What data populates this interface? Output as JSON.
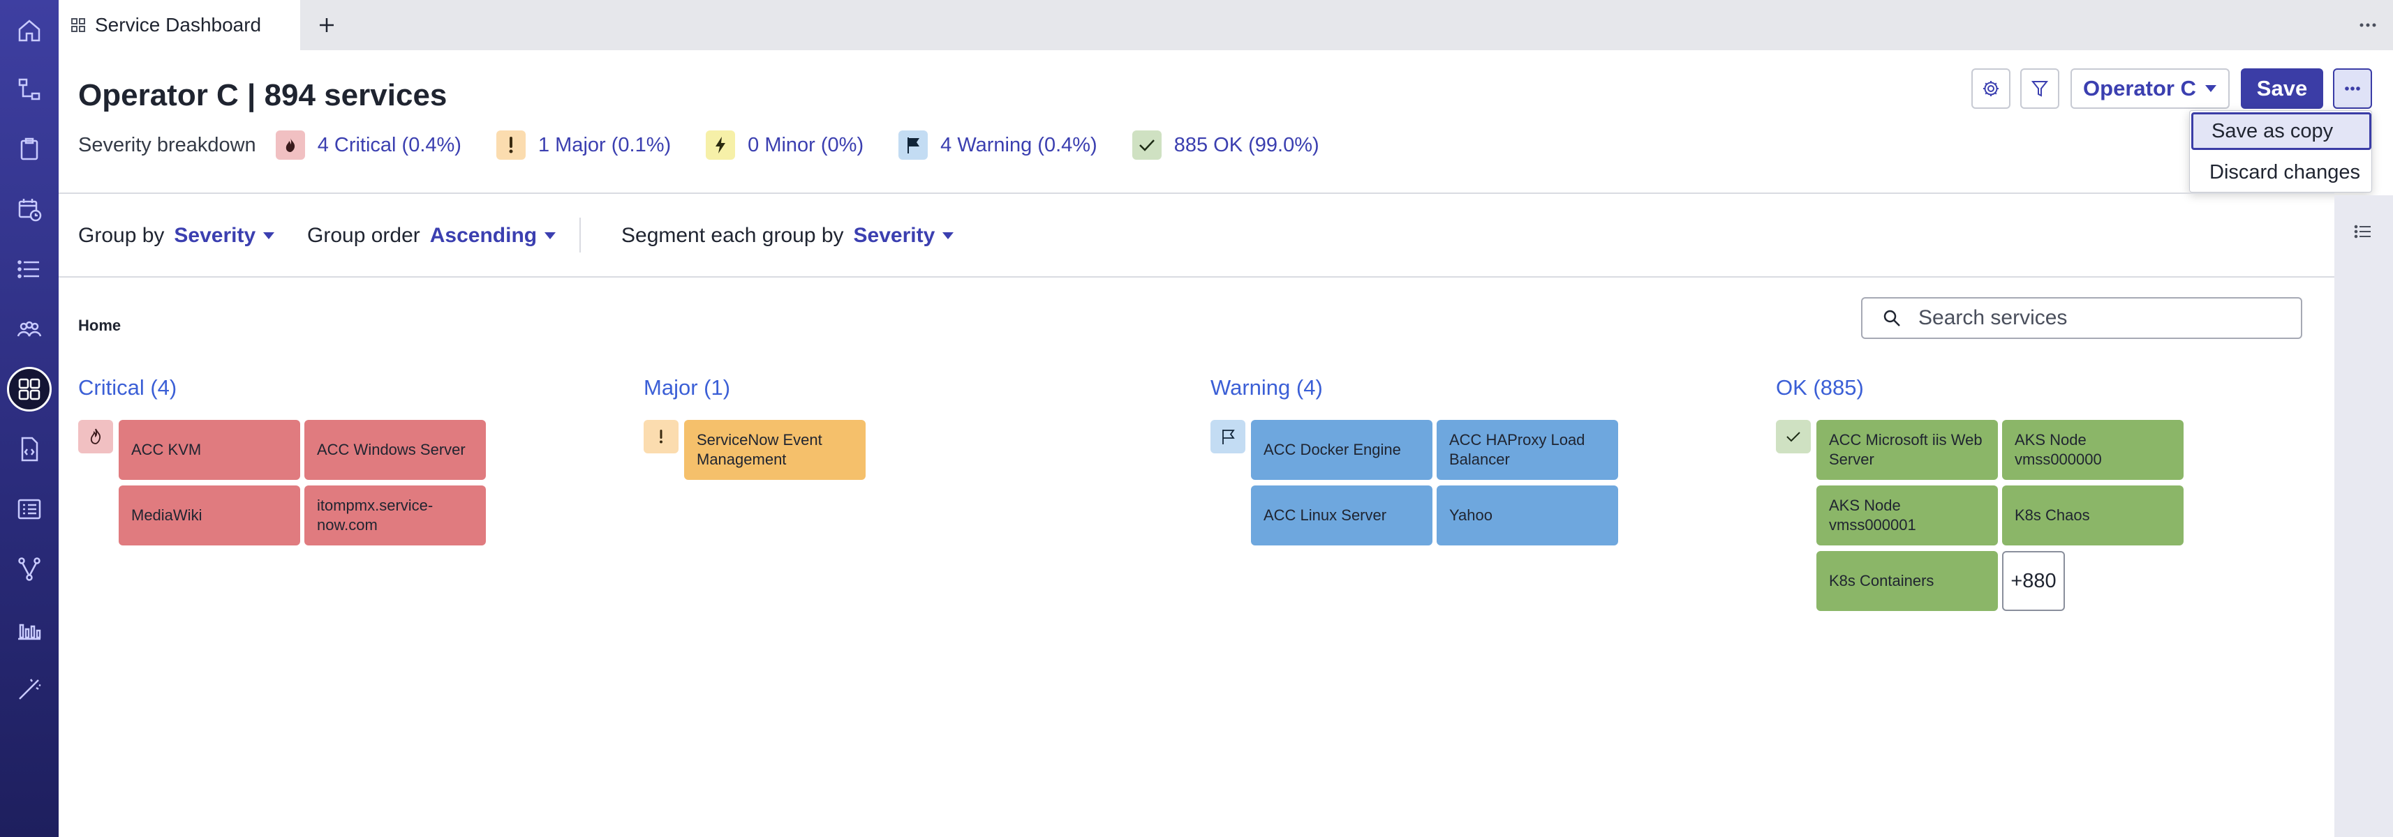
{
  "tab": {
    "title": "Service Dashboard",
    "add_label": "+",
    "overflow_label": "···"
  },
  "header": {
    "title": "Operator C | 894 services",
    "breakdown_label": "Severity breakdown",
    "severities": [
      {
        "key": "critical",
        "label": "4 Critical (0.4%)",
        "icon": "critical-icon",
        "color": "#f1c0c2"
      },
      {
        "key": "major",
        "label": "1 Major (0.1%)",
        "icon": "major-icon",
        "color": "#fbdcaf"
      },
      {
        "key": "minor",
        "label": "0 Minor (0%)",
        "icon": "minor-icon",
        "color": "#f6f0a8"
      },
      {
        "key": "warning",
        "label": "4 Warning (0.4%)",
        "icon": "warning-icon",
        "color": "#c3dcf3"
      },
      {
        "key": "ok",
        "label": "885 OK (99.0%)",
        "icon": "ok-icon",
        "color": "#cfe1c2"
      }
    ],
    "operator_label": "Operator C",
    "save_label": "Save"
  },
  "overflow_menu": {
    "items": [
      "Save as copy",
      "Discard changes"
    ],
    "selected": "Save as copy"
  },
  "toolbar": {
    "group_by_label": "Group by",
    "group_by_value": "Severity",
    "group_order_label": "Group order",
    "group_order_value": "Ascending",
    "segment_label": "Segment each group by",
    "segment_value": "Severity"
  },
  "breadcrumb": "Home",
  "search": {
    "placeholder": "Search services",
    "value": ""
  },
  "groups": {
    "critical": {
      "title": "Critical (4)",
      "cards": [
        "ACC KVM",
        "ACC Windows Server",
        "MediaWiki",
        "itompmx.service-now.com"
      ]
    },
    "major": {
      "title": "Major (1)",
      "cards": [
        "ServiceNow Event Management"
      ]
    },
    "warning": {
      "title": "Warning (4)",
      "cards": [
        "ACC Docker Engine",
        "ACC HAProxy Load Balancer",
        "ACC Linux Server",
        "Yahoo"
      ]
    },
    "ok": {
      "title": "OK (885)",
      "cards": [
        "ACC Microsoft iis Web Server",
        "AKS Node vmss000000",
        "AKS Node vmss000001",
        "K8s Chaos",
        "K8s Containers"
      ],
      "more_label": "+880"
    }
  },
  "colors": {
    "accent": "#3b3da6",
    "critical": "#e07b7f",
    "major": "#f5c06b",
    "warning": "#6ea7de",
    "ok": "#8bb668",
    "rail": "#2f3088"
  }
}
